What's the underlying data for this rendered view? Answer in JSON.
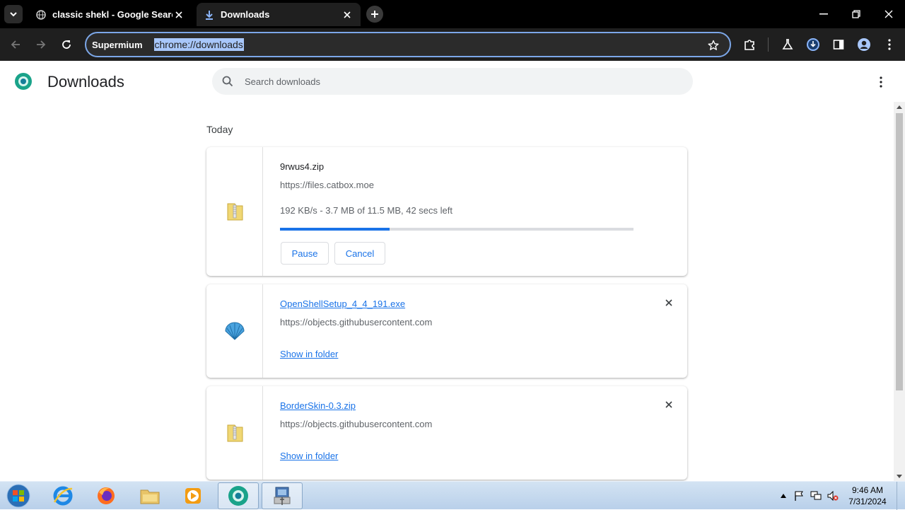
{
  "browser": {
    "tabs": [
      {
        "title": "classic shekl - Google Search",
        "icon": "globe-icon",
        "active": false
      },
      {
        "title": "Downloads",
        "icon": "download-icon",
        "active": true
      }
    ],
    "omnibox": {
      "label": "Supermium",
      "url": "chrome://downloads"
    }
  },
  "page": {
    "title": "Downloads",
    "search_placeholder": "Search downloads",
    "date_heading": "Today",
    "downloads": [
      {
        "filename": "9rwus4.zip",
        "source": "https://files.catbox.moe",
        "status": "192 KB/s - 3.7 MB of 11.5 MB, 42 secs left",
        "progress_percent": 31,
        "buttons": [
          "Pause",
          "Cancel"
        ],
        "icon": "zip-folder-icon"
      },
      {
        "filename": "OpenShellSetup_4_4_191.exe",
        "source": "https://objects.githubusercontent.com",
        "action": "Show in folder",
        "icon": "shell-icon"
      },
      {
        "filename": "BorderSkin-0.3.zip",
        "source": "https://objects.githubusercontent.com",
        "action": "Show in folder",
        "icon": "zip-folder-icon"
      }
    ]
  },
  "taskbar": {
    "apps": [
      "internet-explorer-icon",
      "firefox-icon",
      "file-explorer-icon",
      "media-player-icon",
      "supermium-icon",
      "setup-icon"
    ],
    "clock": {
      "time": "9:46 AM",
      "date": "7/31/2024"
    }
  },
  "colors": {
    "accent": "#1a73e8",
    "omnibox_border": "#7ca7e8",
    "tab_bg": "#1f1f1f"
  }
}
